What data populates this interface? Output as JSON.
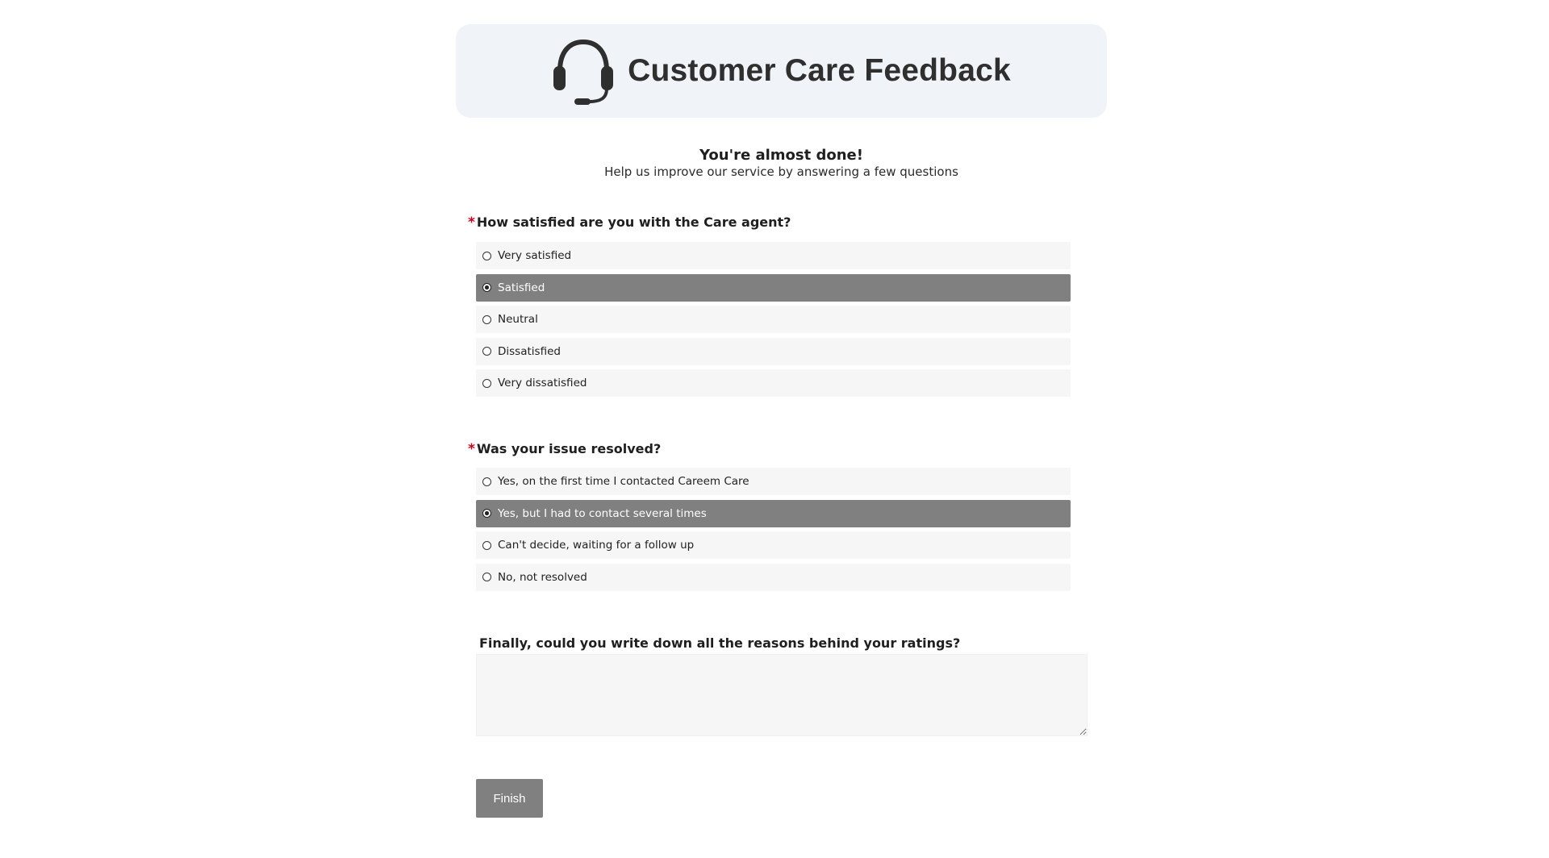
{
  "header": {
    "title": "Customer Care Feedback",
    "icon": "headset-icon"
  },
  "intro": {
    "title": "You're almost done!",
    "subtitle": "Help us improve our service by answering a few questions"
  },
  "q1": {
    "required_mark": "*",
    "label": "How satisfied are you with the Care agent?",
    "options": [
      {
        "label": "Very satisfied",
        "selected": false
      },
      {
        "label": "Satisfied",
        "selected": true
      },
      {
        "label": "Neutral",
        "selected": false
      },
      {
        "label": "Dissatisfied",
        "selected": false
      },
      {
        "label": "Very dissatisfied",
        "selected": false
      }
    ]
  },
  "q2": {
    "required_mark": "*",
    "label": "Was your issue resolved?",
    "options": [
      {
        "label": "Yes, on the first time I contacted Careem Care",
        "selected": false
      },
      {
        "label": "Yes, but I had to contact several times",
        "selected": true
      },
      {
        "label": "Can't decide, waiting for a follow up",
        "selected": false
      },
      {
        "label": "No, not resolved",
        "selected": false
      }
    ]
  },
  "q3": {
    "label": "Finally, could you write down all the reasons behind your ratings?",
    "value": ""
  },
  "finish_label": "Finish",
  "colors": {
    "header_bg": "#f0f3f7",
    "selected_bg": "#808080",
    "option_bg": "#f6f6f6",
    "required": "#d0021b",
    "button_bg": "#808080"
  }
}
